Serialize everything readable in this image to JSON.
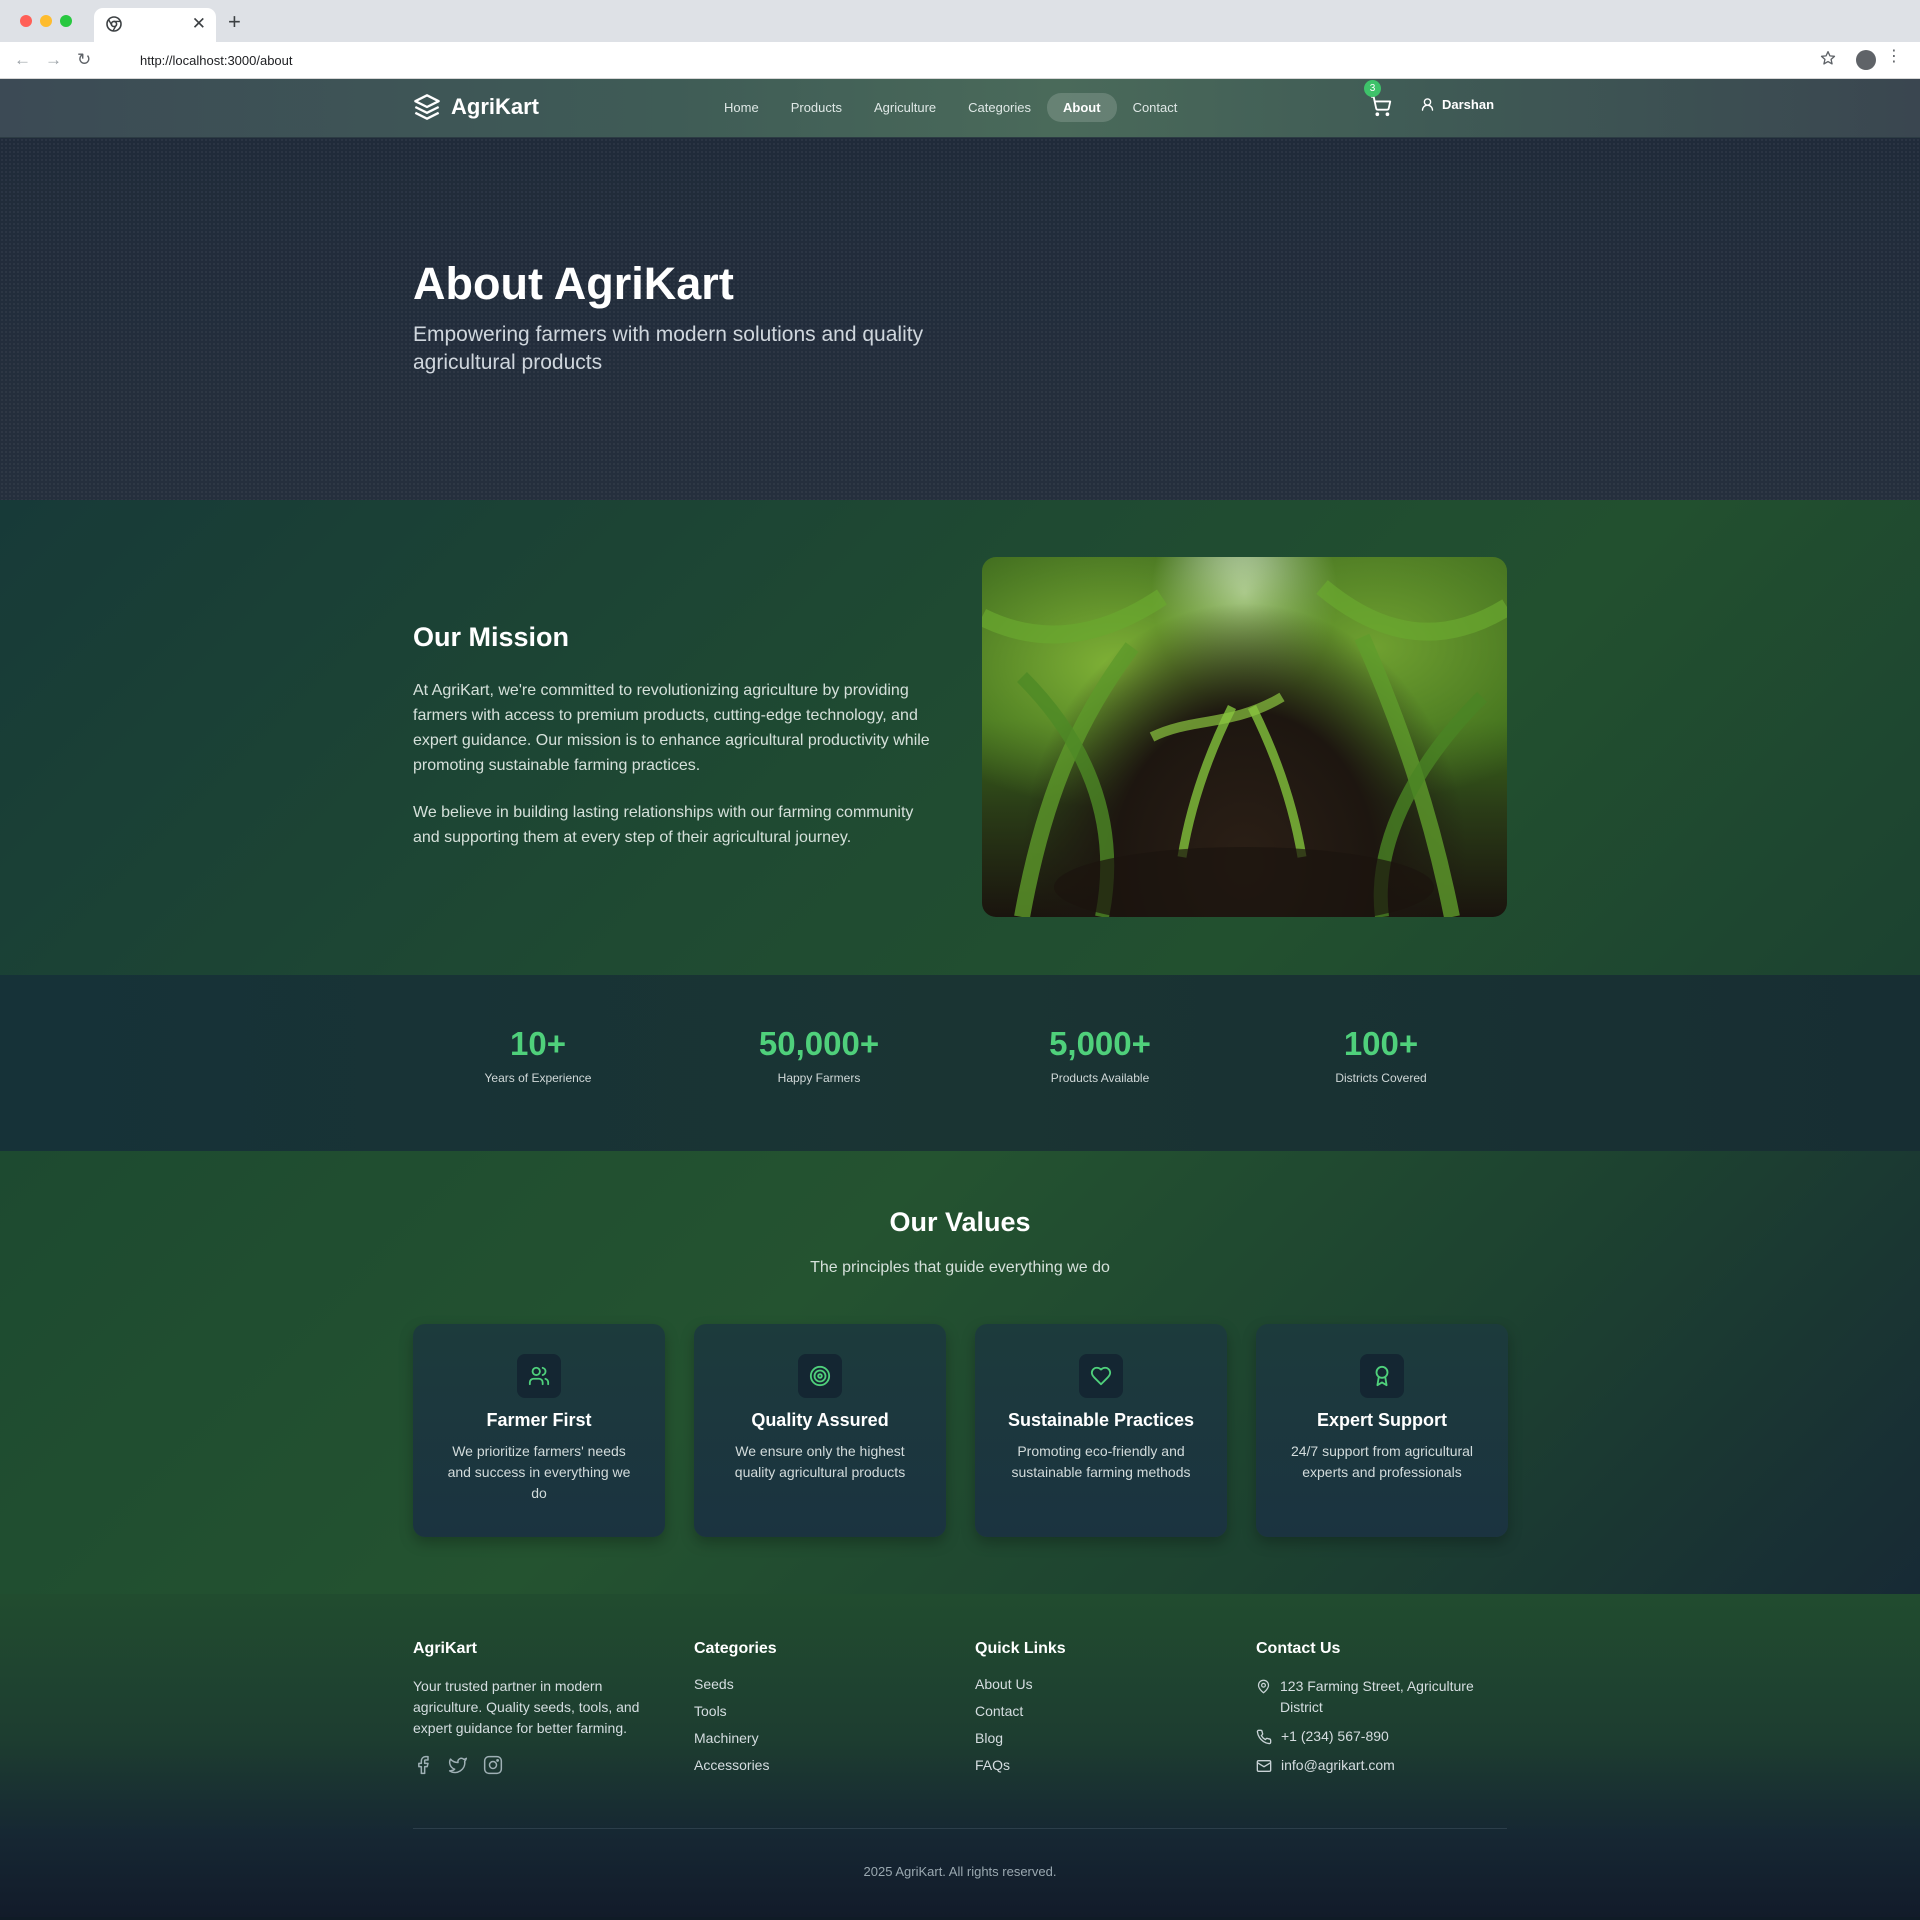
{
  "browser": {
    "url": "http://localhost:3000/about",
    "tab_close": "✕",
    "new_tab": "+"
  },
  "header": {
    "brand": "AgriKart",
    "nav": [
      "Home",
      "Products",
      "Agriculture",
      "Categories",
      "About",
      "Contact"
    ],
    "active_nav": "About",
    "cart_count": "3",
    "user_name": "Darshan"
  },
  "hero": {
    "title": "About AgriKart",
    "subtitle": "Empowering farmers with modern solutions and quality agricultural products"
  },
  "mission": {
    "title": "Our Mission",
    "paragraph1": "At AgriKart, we're committed to revolutionizing agriculture by providing farmers with access to premium products, cutting-edge technology, and expert guidance. Our mission is to enhance agricultural productivity while promoting sustainable farming practices.",
    "paragraph2": "We believe in building lasting relationships with our farming community and supporting them at every step of their agricultural journey."
  },
  "stats": [
    {
      "value": "10+",
      "label": "Years of Experience"
    },
    {
      "value": "50,000+",
      "label": "Happy Farmers"
    },
    {
      "value": "5,000+",
      "label": "Products Available"
    },
    {
      "value": "100+",
      "label": "Districts Covered"
    }
  ],
  "values": {
    "title": "Our Values",
    "subtitle": "The principles that guide everything we do",
    "cards": [
      {
        "icon": "users-icon",
        "title": "Farmer First",
        "description": "We prioritize farmers' needs and success in everything we do"
      },
      {
        "icon": "target-icon",
        "title": "Quality Assured",
        "description": "We ensure only the highest quality agricultural products"
      },
      {
        "icon": "heart-icon",
        "title": "Sustainable Practices",
        "description": "Promoting eco-friendly and sustainable farming methods"
      },
      {
        "icon": "award-icon",
        "title": "Expert Support",
        "description": "24/7 support from agricultural experts and professionals"
      }
    ]
  },
  "footer": {
    "about_title": "AgriKart",
    "about_text": "Your trusted partner in modern agriculture. Quality seeds, tools, and expert guidance for better farming.",
    "categories_title": "Categories",
    "categories": [
      "Seeds",
      "Tools",
      "Machinery",
      "Accessories"
    ],
    "quick_links_title": "Quick Links",
    "quick_links": [
      "About Us",
      "Contact",
      "Blog",
      "FAQs"
    ],
    "contact_title": "Contact Us",
    "address": "123 Farming Street, Agriculture District",
    "phone": "+1 (234) 567-890",
    "email": "info@agrikart.com",
    "copyright": "2025 AgriKart. All rights reserved."
  },
  "colors": {
    "accent": "#4fd07b",
    "badge": "#3ec26a"
  }
}
